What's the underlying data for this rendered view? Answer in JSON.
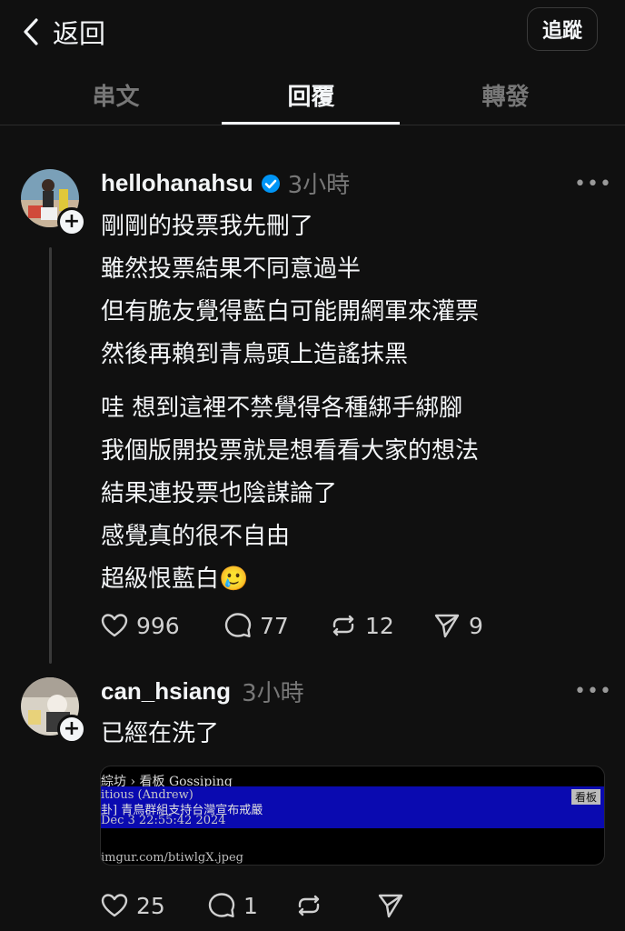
{
  "header": {
    "back_label": "返回",
    "follow_label": "追蹤"
  },
  "tabs": [
    {
      "label": "串文",
      "active": false
    },
    {
      "label": "回覆",
      "active": true
    },
    {
      "label": "轉發",
      "active": false
    }
  ],
  "post": {
    "username": "hellohanahsu",
    "verified": true,
    "time": "3小時",
    "more": "•••",
    "lines_p1": [
      "剛剛的投票我先刪了",
      "雖然投票結果不同意過半",
      "但有脆友覺得藍白可能開網軍來灌票",
      "然後再賴到青鳥頭上造謠抹黑"
    ],
    "lines_p2": [
      "哇 想到這裡不禁覺得各種綁手綁腳",
      "我個版開投票就是想看看大家的想法",
      "結果連投票也陰謀論了",
      "感覺真的很不自由",
      "超級恨藍白"
    ],
    "emoji": "🥲",
    "likes": "996",
    "comments": "77",
    "reposts": "12",
    "shares": "9"
  },
  "reply": {
    "username": "can_hsiang",
    "time": "3小時",
    "more": "•••",
    "text": "已經在洗了",
    "likes": "25",
    "comments": "1",
    "embed": {
      "crumb": "綜坊 › 看板 Gossiping",
      "author_line": "itious (Andrew)",
      "title_line": "卦] 青鳥群組支持台灣宣布戒嚴",
      "date_line": "Dec  3 22:55:42 2024",
      "tag": "看板",
      "url": "imgur.com/btiwlgX.jpeg"
    }
  },
  "colors": {
    "background": "#101010",
    "verified": "#0095f6",
    "muted": "#777777"
  }
}
